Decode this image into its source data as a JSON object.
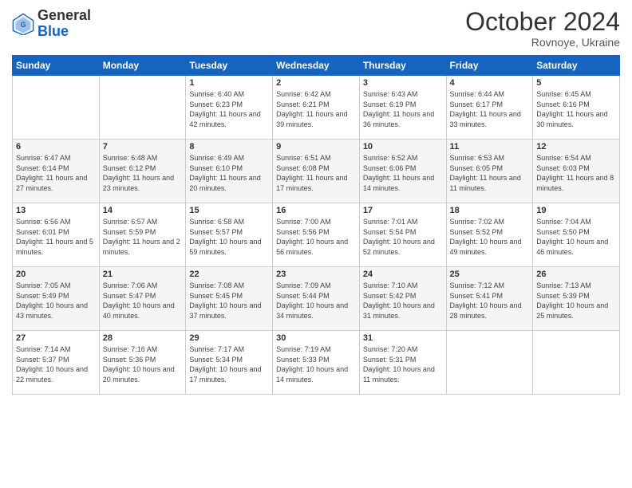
{
  "header": {
    "logo_general": "General",
    "logo_blue": "Blue",
    "month_title": "October 2024",
    "subtitle": "Rovnoye, Ukraine"
  },
  "days_of_week": [
    "Sunday",
    "Monday",
    "Tuesday",
    "Wednesday",
    "Thursday",
    "Friday",
    "Saturday"
  ],
  "weeks": [
    [
      {
        "day": "",
        "info": ""
      },
      {
        "day": "",
        "info": ""
      },
      {
        "day": "1",
        "info": "Sunrise: 6:40 AM\nSunset: 6:23 PM\nDaylight: 11 hours and 42 minutes."
      },
      {
        "day": "2",
        "info": "Sunrise: 6:42 AM\nSunset: 6:21 PM\nDaylight: 11 hours and 39 minutes."
      },
      {
        "day": "3",
        "info": "Sunrise: 6:43 AM\nSunset: 6:19 PM\nDaylight: 11 hours and 36 minutes."
      },
      {
        "day": "4",
        "info": "Sunrise: 6:44 AM\nSunset: 6:17 PM\nDaylight: 11 hours and 33 minutes."
      },
      {
        "day": "5",
        "info": "Sunrise: 6:45 AM\nSunset: 6:16 PM\nDaylight: 11 hours and 30 minutes."
      }
    ],
    [
      {
        "day": "6",
        "info": "Sunrise: 6:47 AM\nSunset: 6:14 PM\nDaylight: 11 hours and 27 minutes."
      },
      {
        "day": "7",
        "info": "Sunrise: 6:48 AM\nSunset: 6:12 PM\nDaylight: 11 hours and 23 minutes."
      },
      {
        "day": "8",
        "info": "Sunrise: 6:49 AM\nSunset: 6:10 PM\nDaylight: 11 hours and 20 minutes."
      },
      {
        "day": "9",
        "info": "Sunrise: 6:51 AM\nSunset: 6:08 PM\nDaylight: 11 hours and 17 minutes."
      },
      {
        "day": "10",
        "info": "Sunrise: 6:52 AM\nSunset: 6:06 PM\nDaylight: 11 hours and 14 minutes."
      },
      {
        "day": "11",
        "info": "Sunrise: 6:53 AM\nSunset: 6:05 PM\nDaylight: 11 hours and 11 minutes."
      },
      {
        "day": "12",
        "info": "Sunrise: 6:54 AM\nSunset: 6:03 PM\nDaylight: 11 hours and 8 minutes."
      }
    ],
    [
      {
        "day": "13",
        "info": "Sunrise: 6:56 AM\nSunset: 6:01 PM\nDaylight: 11 hours and 5 minutes."
      },
      {
        "day": "14",
        "info": "Sunrise: 6:57 AM\nSunset: 5:59 PM\nDaylight: 11 hours and 2 minutes."
      },
      {
        "day": "15",
        "info": "Sunrise: 6:58 AM\nSunset: 5:57 PM\nDaylight: 10 hours and 59 minutes."
      },
      {
        "day": "16",
        "info": "Sunrise: 7:00 AM\nSunset: 5:56 PM\nDaylight: 10 hours and 56 minutes."
      },
      {
        "day": "17",
        "info": "Sunrise: 7:01 AM\nSunset: 5:54 PM\nDaylight: 10 hours and 52 minutes."
      },
      {
        "day": "18",
        "info": "Sunrise: 7:02 AM\nSunset: 5:52 PM\nDaylight: 10 hours and 49 minutes."
      },
      {
        "day": "19",
        "info": "Sunrise: 7:04 AM\nSunset: 5:50 PM\nDaylight: 10 hours and 46 minutes."
      }
    ],
    [
      {
        "day": "20",
        "info": "Sunrise: 7:05 AM\nSunset: 5:49 PM\nDaylight: 10 hours and 43 minutes."
      },
      {
        "day": "21",
        "info": "Sunrise: 7:06 AM\nSunset: 5:47 PM\nDaylight: 10 hours and 40 minutes."
      },
      {
        "day": "22",
        "info": "Sunrise: 7:08 AM\nSunset: 5:45 PM\nDaylight: 10 hours and 37 minutes."
      },
      {
        "day": "23",
        "info": "Sunrise: 7:09 AM\nSunset: 5:44 PM\nDaylight: 10 hours and 34 minutes."
      },
      {
        "day": "24",
        "info": "Sunrise: 7:10 AM\nSunset: 5:42 PM\nDaylight: 10 hours and 31 minutes."
      },
      {
        "day": "25",
        "info": "Sunrise: 7:12 AM\nSunset: 5:41 PM\nDaylight: 10 hours and 28 minutes."
      },
      {
        "day": "26",
        "info": "Sunrise: 7:13 AM\nSunset: 5:39 PM\nDaylight: 10 hours and 25 minutes."
      }
    ],
    [
      {
        "day": "27",
        "info": "Sunrise: 7:14 AM\nSunset: 5:37 PM\nDaylight: 10 hours and 22 minutes."
      },
      {
        "day": "28",
        "info": "Sunrise: 7:16 AM\nSunset: 5:36 PM\nDaylight: 10 hours and 20 minutes."
      },
      {
        "day": "29",
        "info": "Sunrise: 7:17 AM\nSunset: 5:34 PM\nDaylight: 10 hours and 17 minutes."
      },
      {
        "day": "30",
        "info": "Sunrise: 7:19 AM\nSunset: 5:33 PM\nDaylight: 10 hours and 14 minutes."
      },
      {
        "day": "31",
        "info": "Sunrise: 7:20 AM\nSunset: 5:31 PM\nDaylight: 10 hours and 11 minutes."
      },
      {
        "day": "",
        "info": ""
      },
      {
        "day": "",
        "info": ""
      }
    ]
  ]
}
